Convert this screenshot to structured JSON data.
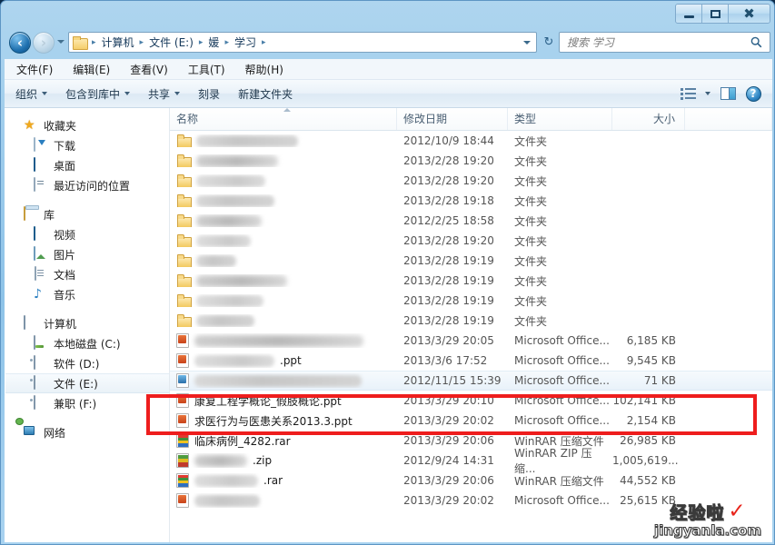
{
  "window": {
    "minimize_label": "–",
    "maximize_label": "□",
    "close_label": "✕"
  },
  "address": {
    "back_label": "←",
    "forward_label": "→",
    "refresh_label": "↻",
    "folder_icon": "folder-icon",
    "breadcrumbs": [
      {
        "label": "计算机"
      },
      {
        "label": "文件 (E:)"
      },
      {
        "label": "媛"
      },
      {
        "label": "学习"
      }
    ],
    "separator": "▸"
  },
  "search": {
    "placeholder": "搜索 学习",
    "value": "",
    "icon": "search-icon"
  },
  "menubar": {
    "items": [
      {
        "label": "文件(F)"
      },
      {
        "label": "编辑(E)"
      },
      {
        "label": "查看(V)"
      },
      {
        "label": "工具(T)"
      },
      {
        "label": "帮助(H)"
      }
    ]
  },
  "toolbar": {
    "organize_label": "组织",
    "include_library_label": "包含到库中",
    "share_label": "共享",
    "burn_label": "刻录",
    "new_folder_label": "新建文件夹",
    "views_icon": "views-list-icon",
    "preview_pane_icon": "preview-pane-icon",
    "help_icon": "help-icon",
    "help_label": "?"
  },
  "sidebar": {
    "groups": [
      {
        "header": {
          "label": "收藏夹",
          "icon": "star-icon"
        },
        "items": [
          {
            "label": "下载",
            "icon": "download-icon"
          },
          {
            "label": "桌面",
            "icon": "desktop-icon"
          },
          {
            "label": "最近访问的位置",
            "icon": "recent-places-icon"
          }
        ]
      },
      {
        "header": {
          "label": "库",
          "icon": "library-icon"
        },
        "items": [
          {
            "label": "视频",
            "icon": "video-icon"
          },
          {
            "label": "图片",
            "icon": "pictures-icon"
          },
          {
            "label": "文档",
            "icon": "documents-icon"
          },
          {
            "label": "音乐",
            "icon": "music-icon"
          }
        ]
      },
      {
        "header": {
          "label": "计算机",
          "icon": "computer-icon"
        },
        "items": [
          {
            "label": "本地磁盘 (C:)",
            "icon": "local-disk-icon",
            "selected": false
          },
          {
            "label": "软件 (D:)",
            "icon": "drive-icon",
            "selected": false
          },
          {
            "label": "文件 (E:)",
            "icon": "drive-icon",
            "selected": true
          },
          {
            "label": "兼职 (F:)",
            "icon": "drive-icon",
            "selected": false
          }
        ]
      },
      {
        "header": {
          "label": "网络",
          "icon": "network-icon"
        },
        "items": []
      }
    ]
  },
  "filelist": {
    "columns": [
      {
        "key": "name",
        "label": "名称",
        "sorted": "asc"
      },
      {
        "key": "date",
        "label": "修改日期"
      },
      {
        "key": "type",
        "label": "类型"
      },
      {
        "key": "size",
        "label": "大小"
      }
    ],
    "rows": [
      {
        "name": "",
        "redacted": true,
        "redact_w": 112,
        "icon": "folder-icon",
        "date": "2012/10/9 18:44",
        "type": "文件夹",
        "size": ""
      },
      {
        "name": "",
        "redacted": true,
        "redact_w": 90,
        "icon": "folder-icon",
        "date": "2013/2/28 19:20",
        "type": "文件夹",
        "size": ""
      },
      {
        "name": "",
        "redacted": true,
        "redact_w": 76,
        "icon": "folder-icon",
        "date": "2013/2/28 19:20",
        "type": "文件夹",
        "size": ""
      },
      {
        "name": "",
        "redacted": true,
        "redact_w": 86,
        "icon": "folder-icon",
        "date": "2013/2/28 19:18",
        "type": "文件夹",
        "size": ""
      },
      {
        "name": "",
        "redacted": true,
        "redact_w": 72,
        "icon": "folder-icon",
        "date": "2012/2/25 18:58",
        "type": "文件夹",
        "size": ""
      },
      {
        "name": "",
        "redacted": true,
        "redact_w": 60,
        "icon": "folder-icon",
        "date": "2013/2/28 19:20",
        "type": "文件夹",
        "size": ""
      },
      {
        "name": "",
        "redacted": true,
        "redact_w": 44,
        "icon": "folder-icon",
        "date": "2013/2/28 19:19",
        "type": "文件夹",
        "size": ""
      },
      {
        "name": "",
        "redacted": true,
        "redact_w": 100,
        "icon": "folder-icon",
        "date": "2013/2/28 19:19",
        "type": "文件夹",
        "size": ""
      },
      {
        "name": "",
        "redacted": true,
        "redact_w": 74,
        "icon": "folder-icon",
        "date": "2013/2/28 19:19",
        "type": "文件夹",
        "size": ""
      },
      {
        "name": "",
        "redacted": true,
        "redact_w": 64,
        "icon": "folder-icon",
        "date": "2013/2/28 19:19",
        "type": "文件夹",
        "size": ""
      },
      {
        "name": "",
        "redacted": true,
        "redact_w": 186,
        "icon": "ppt-icon",
        "date": "2013/3/29 20:05",
        "type": "Microsoft Office...",
        "size": "6,185 KB"
      },
      {
        "name": ".ppt",
        "redacted": true,
        "redact_w": 88,
        "icon": "ppt-icon",
        "date": "2013/3/6 17:52",
        "type": "Microsoft Office...",
        "size": "9,545 KB"
      },
      {
        "name": "",
        "redacted": true,
        "redact_w": 184,
        "icon": "xls-icon",
        "date": "2012/11/15 15:39",
        "type": "Microsoft Office...",
        "size": "71 KB",
        "highlighted": true
      },
      {
        "name": "康复工程学概论_假肢概论.ppt",
        "redacted": false,
        "icon": "ppt-icon",
        "date": "2013/3/29 20:10",
        "type": "Microsoft Office...",
        "size": "102,141 KB"
      },
      {
        "name": "求医行为与医患关系2013.3.ppt",
        "redacted": false,
        "icon": "ppt-icon",
        "date": "2013/3/29 20:02",
        "type": "Microsoft Office...",
        "size": "2,154 KB",
        "boxed": true
      },
      {
        "name": "临床病例_4282.rar",
        "redacted": false,
        "icon": "rar-icon",
        "date": "2013/3/29 20:06",
        "type": "WinRAR 压缩文件",
        "size": "26,985 KB"
      },
      {
        "name": ".zip",
        "redacted": true,
        "redact_w": 58,
        "icon": "zip-icon",
        "date": "2012/9/24 14:31",
        "type": "WinRAR ZIP 压缩...",
        "size": "1,005,619..."
      },
      {
        "name": ".rar",
        "redacted": true,
        "redact_w": 70,
        "icon": "rar-icon",
        "date": "2013/3/29 20:06",
        "type": "WinRAR 压缩文件",
        "size": "44,552 KB"
      },
      {
        "name": "",
        "redacted": true,
        "redact_w": 72,
        "icon": "ppt-icon",
        "date": "2013/3/29 20:02",
        "type": "Microsoft Office...",
        "size": "25,615 KB"
      }
    ]
  },
  "annotation": {
    "highlight_color": "#ee1d1d",
    "target_file": "求医行为与医患关系2013.3.ppt"
  },
  "watermark": {
    "brand": "经验啦",
    "check": "✓",
    "url": "jingyanla.com"
  }
}
